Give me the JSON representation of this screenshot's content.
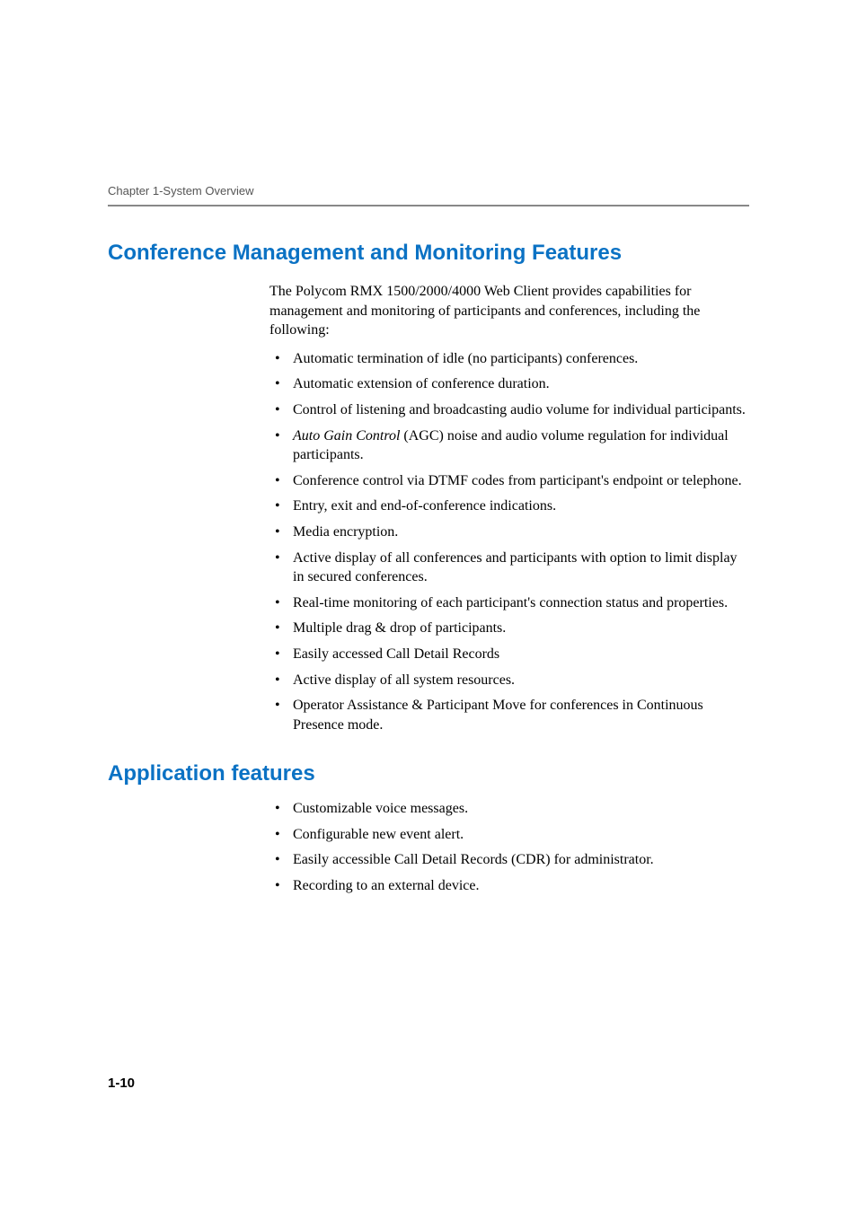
{
  "header": {
    "running": "Chapter 1-System Overview"
  },
  "sections": {
    "conf_mgmt": {
      "title": "Conference Management and Monitoring Features",
      "intro": "The Polycom RMX 1500/2000/4000 Web Client provides capabilities for management and monitoring of participants and conferences, including the following:",
      "items": {
        "i0": "Automatic termination of idle (no participants) conferences.",
        "i1": "Automatic extension of conference duration.",
        "i2": "Control of listening and broadcasting audio volume for individual participants.",
        "i3_em": "Auto Gain Control",
        "i3_rest": " (AGC) noise and audio volume regulation for individual participants.",
        "i4": "Conference control via DTMF codes from participant's endpoint or telephone.",
        "i5": "Entry, exit and end-of-conference indications.",
        "i6": "Media encryption.",
        "i7": "Active display of all conferences and participants with option to limit display in secured conferences.",
        "i8": "Real-time monitoring of each participant's connection status and properties.",
        "i9": "Multiple drag & drop of participants.",
        "i10": "Easily accessed Call Detail Records",
        "i11": "Active display of all system resources.",
        "i12": "Operator Assistance & Participant Move for conferences in Continuous Presence mode."
      }
    },
    "app_features": {
      "title": "Application features",
      "items": {
        "a0": "Customizable voice messages.",
        "a1": "Configurable new event alert.",
        "a2": "Easily accessible Call Detail Records (CDR) for administrator.",
        "a3": "Recording to an external device."
      }
    }
  },
  "footer": {
    "page_number": "1-10"
  }
}
